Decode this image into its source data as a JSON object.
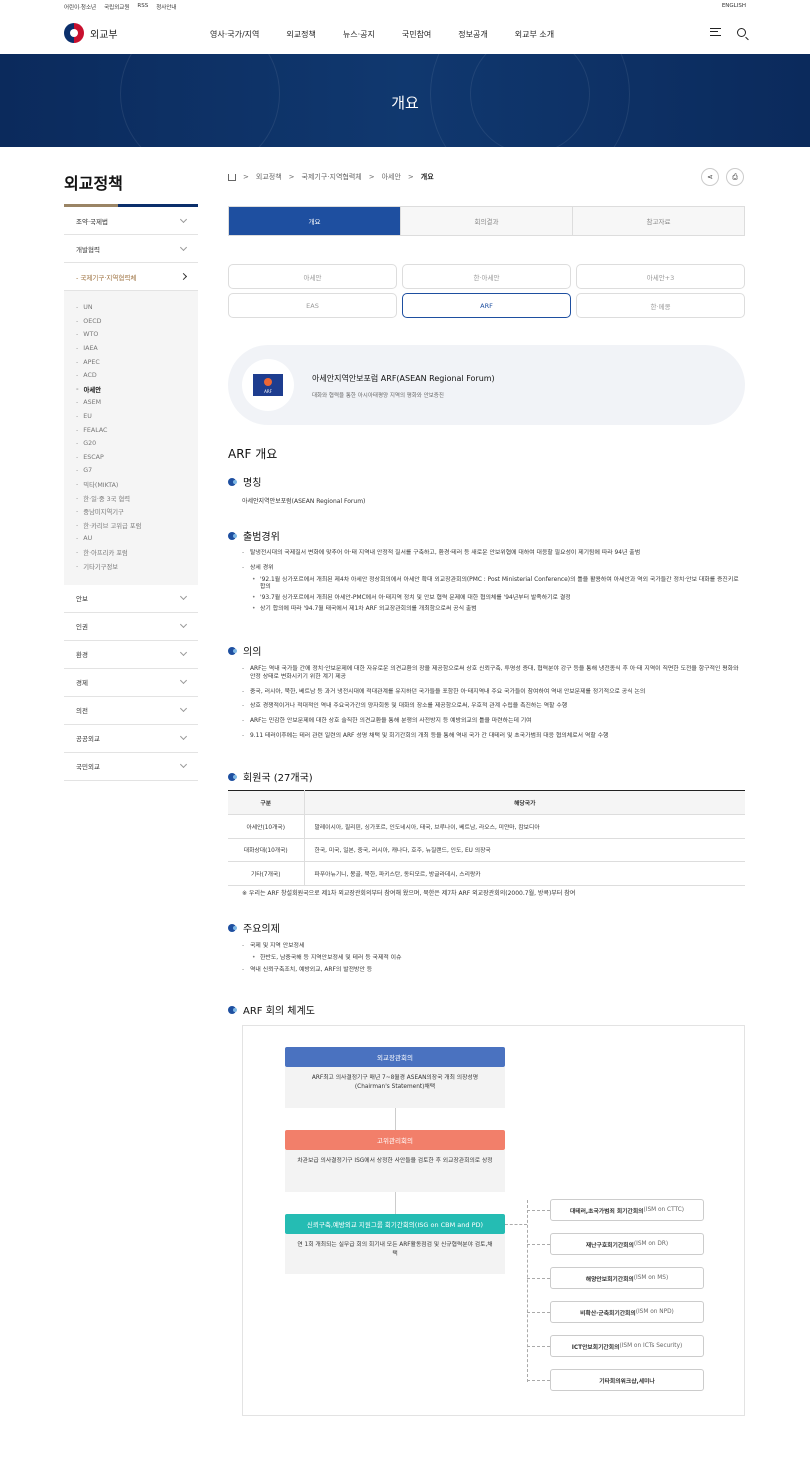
{
  "header": {
    "util_links": [
      "어린이·청소년",
      "국립외교원",
      "RSS",
      "청사안내"
    ],
    "lang": "ENGLISH",
    "logo_text": "외교부",
    "gnb": [
      "영사·국가/지역",
      "외교정책",
      "뉴스·공지",
      "국민참여",
      "정보공개",
      "외교부 소개"
    ],
    "icons": [
      "menu-icon",
      "search-icon"
    ]
  },
  "banner": {
    "title": "개요"
  },
  "sidebar": {
    "title": "외교정책",
    "items": [
      "조약·국제법",
      "개발협력",
      "국제기구·지역협력체",
      "안보",
      "인권",
      "환경",
      "경제",
      "의전",
      "공공외교",
      "국민외교"
    ],
    "active_item": "국제기구·지역협력체",
    "sub_items": [
      "UN",
      "OECD",
      "WTO",
      "IAEA",
      "APEC",
      "ACD",
      "아세안",
      "ASEM",
      "EU",
      "FEALAC",
      "G20",
      "ESCAP",
      "G7",
      "믹타(MIKTA)",
      "한·일·중 3국 협력",
      "중남미지역기구",
      "한·카리브 고위급 포럼",
      "AU",
      "한·아프리카 포럼",
      "기타기구정보"
    ],
    "active_sub": "아세안"
  },
  "breadcrumb": [
    "외교정책",
    "국제기구·지역협력체",
    "아세안",
    "개요"
  ],
  "tabs": [
    "개요",
    "회의결과",
    "참고자료"
  ],
  "active_tab": "개요",
  "pills": [
    "아세안",
    "한·아세안",
    "아세안+3",
    "EAS",
    "ARF",
    "한·메콩"
  ],
  "active_pill": "ARF",
  "intro": {
    "title": "아세안지역안보포럼 ARF(ASEAN Regional Forum)",
    "desc": "대화와 협력을 통한 아시아태평양 지역의 평화와 안보증진",
    "flag_text": "ARF"
  },
  "content": {
    "h2": "ARF 개요",
    "name_h": "명칭",
    "name_text": "아세안지역안보포럼(ASEAN Regional Forum)",
    "history_h": "출범경위",
    "history": [
      "탈냉전시대의 국제질서 변화에 맞추어 아·태 지역내 안정적 질서를 구축하고, 환경·테러 등 새로운 안보위협에 대하여 대응할 필요성이 제기됨에 따라 94년 출범",
      "상세 경위",
      "'92.1월 싱가포르에서 개최된 제4차 아세안 정상회의에서 아세안 확대 외교장관회의(PMC : Post Ministerial Conference)의 틀을 활용하여 아세안과 역외 국가들간 정치·안보 대화를 증진키로 합의",
      "'93.7월 싱가포르에서 개최된 아세안-PMC에서 아·태지역 정치 및 안보 협력 문제에 대한 협의체를 '94년부터 발족하기로 결정",
      "상기 합의에 따라 '94.7월 태국에서 제1차 ARF 외교장관회의를 개최함으로써 공식 출범"
    ],
    "meaning_h": "의의",
    "meaning": [
      "ARF는 역내 국가들 간에 정치·안보문제에 대한 자유로운 의견교환의 장을 제공함으로써 상호 신뢰구축, 투명성 증대, 협력분야 강구 등을 통해 냉전종식 후 아·태 지역이 직면한 도전을 항구적인 평화와 안정 상태로 변화시키기 위한 계기 제공",
      "중국, 러시아, 북한, 베트남 등 과거 냉전시대에 적대관계를 유지하던 국가들을 포함한 아·태지역내 주요 국가들이 참여하여 역내 안보문제를 정기적으로 공식 논의",
      "상호 경쟁적이거나 적대적인 역내 주요국가간의 양자회동 및 대화의 장소를 제공함으로써, 우호적 관계 수립을 촉진하는 역할 수행",
      "ARF는 민감한 안보문제에 대한 상호 솔직한 의견교환을 통해 분쟁의 사전방지 등 예방외교의 틀을 마련하는데 기여",
      "9.11 테러이후에는 테러 관련 일련의 ARF 성명 채택 및 회기간회의 개최 등을 통해 역내 국가 간 대테러 및 초국가범죄 대응 협의체로서 역할 수행"
    ],
    "members_h": "회원국 (27개국)",
    "table": {
      "headers": [
        "구분",
        "해당국가"
      ],
      "rows": [
        [
          "아세안(10개국)",
          "말레이시아, 필리핀, 싱가포르, 인도네시아, 태국, 브루나이, 베트남, 라오스, 미얀마, 캄보디아"
        ],
        [
          "대화상대(10개국)",
          "한국, 미국, 일본, 중국, 러시아, 캐나다, 호주, 뉴질랜드, 인도, EU 의장국"
        ],
        [
          "기타(7개국)",
          "파푸아뉴기니, 몽골, 북한, 파키스탄, 동티모르, 방글라데시, 스리랑카"
        ]
      ],
      "note": "※ 우리는 ARF 창설회원국으로 제1차 외교장관회의부터 참여해 왔으며, 북한은 제7차 ARF 외교장관회의(2000.7월, 방콕)부터 참여"
    },
    "agenda_h": "주요의제",
    "agenda": [
      "국제 및 지역 안보정세",
      "한반도, 남중국해 등 지역안보정세 및 테러 등 국제적 이슈",
      "역내 신뢰구축조치, 예방외교, ARF의 발전방안 등"
    ],
    "system_h": "ARF 회의 체계도"
  },
  "diagram": {
    "boxes": [
      {
        "title": "외교장관회의",
        "desc": "ARF최고 의사결정기구 매년 7~8월경 ASEAN의장국 개최 의장성명(Chairman's Statement)채택",
        "color": "#4a72c0"
      },
      {
        "title": "고위관리회의",
        "desc": "차관보급 의사결정기구 ISG에서 상정한 사안들을 검토한 후 외교장관회의로 상정",
        "color": "#f27f6a"
      },
      {
        "title": "신뢰구축,예방외교 지원그룹 회기간회의(ISG on CBM and PD)",
        "desc": "연 1회 개최되는 실무급 회의 회기내 모든 ARF활동점검 및 신규협력분야 검토,채택",
        "color": "#25bcb3"
      }
    ],
    "right": [
      {
        "name": "대테러,초국가범죄 회기간회의",
        "en": "(ISM on CTTC)"
      },
      {
        "name": "재난구호회기간회의",
        "en": "(ISM on DR)"
      },
      {
        "name": "해양안보회기간회의",
        "en": "(ISM on MS)"
      },
      {
        "name": "비확산·군축회기간회의",
        "en": "(ISM on NPD)"
      },
      {
        "name": "ICT안보회기간회의",
        "en": "(ISM on ICTs Security)"
      },
      {
        "name": "기타회의워크샵,세미나",
        "en": ""
      }
    ]
  }
}
